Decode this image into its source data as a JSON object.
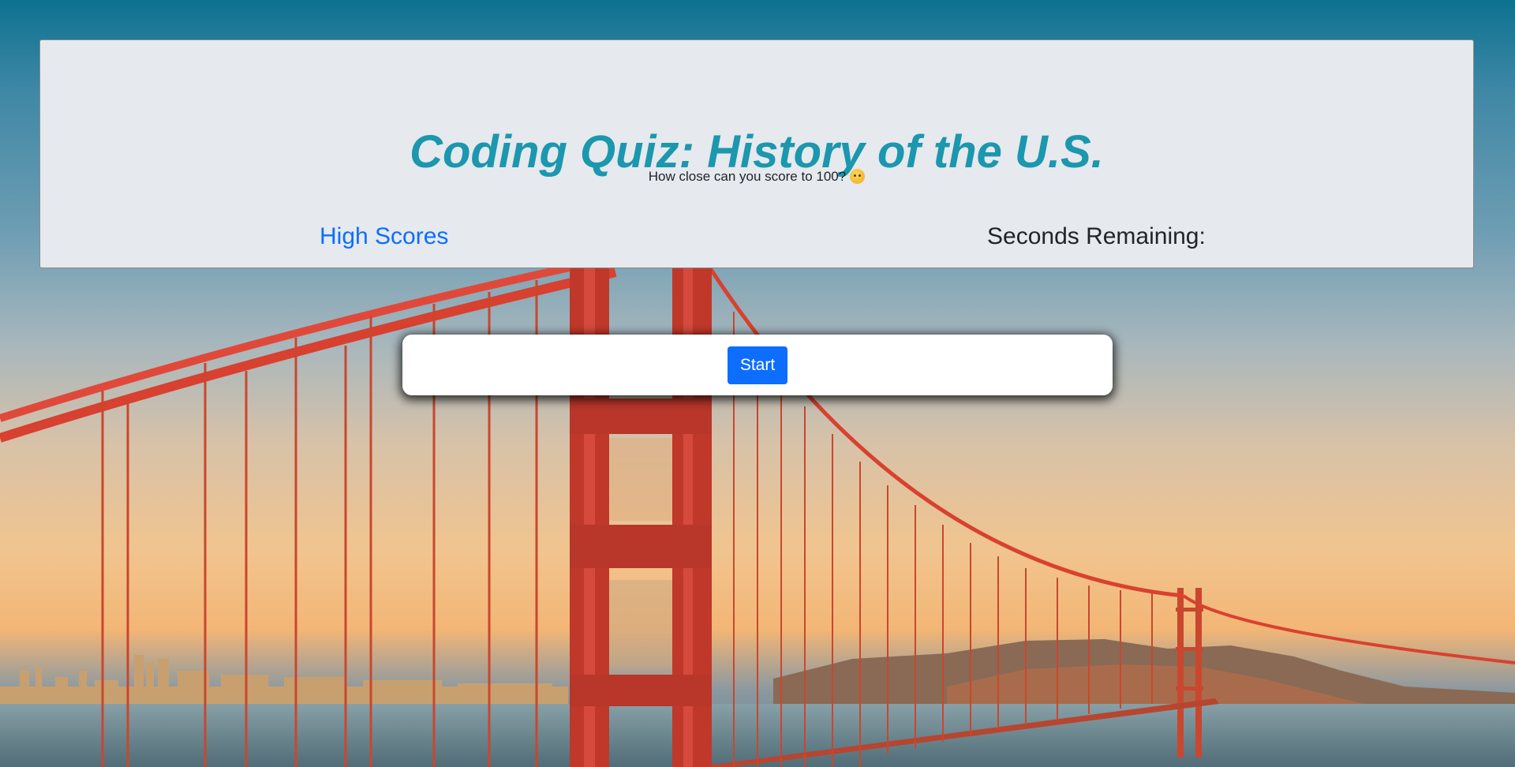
{
  "header": {
    "title": "Coding Quiz: History of the U.S.",
    "subtitle": "How close can you score to 100?",
    "subtitle_emoji_icon": "hushed-face-emoji-icon",
    "high_scores_link": "High Scores",
    "seconds_remaining_label": "Seconds Remaining:",
    "seconds_remaining_value": ""
  },
  "quiz_card": {
    "start_button_label": "Start"
  },
  "colors": {
    "title": "#1b97ae",
    "link": "#0d6efd",
    "button_bg": "#0d6efd",
    "jumbotron_bg": "#e6e9ed",
    "bridge_red": "#d9412f"
  },
  "background_image": "golden-gate-bridge-sunset-photo"
}
